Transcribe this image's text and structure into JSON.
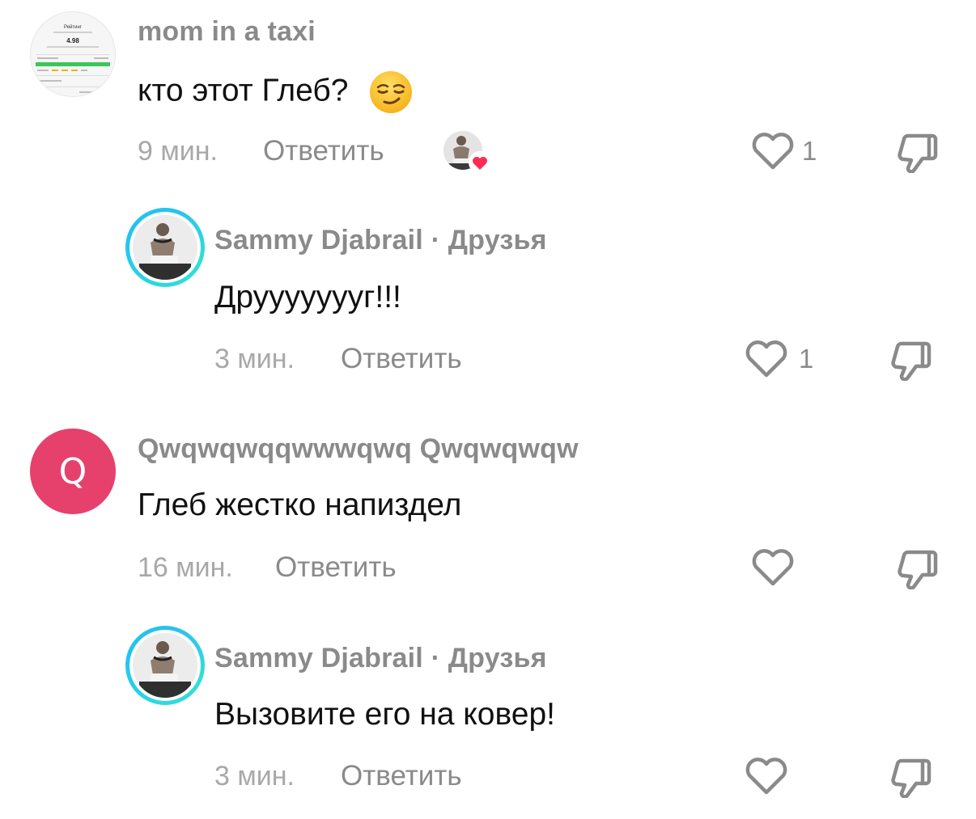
{
  "comments": [
    {
      "username": "mom in a taxi",
      "text": "кто этот Глеб?",
      "emoji": "smirking-face",
      "time": "9 мин.",
      "reply_label": "Ответить",
      "likes": "1",
      "avatar_thumb": {
        "title": "Рейтинг",
        "score": "4.98"
      }
    },
    {
      "username": "Sammy Djabrail",
      "separator": "·",
      "relation": "Друзья",
      "text": "Друууууууг!!!",
      "time": "3 мин.",
      "reply_label": "Ответить",
      "likes": "1"
    },
    {
      "username": "Qwqwqwqqwwwqwq Qwqwqwqw",
      "avatar_letter": "Q",
      "text": "Глеб жестко напиздел",
      "time": "16 мин.",
      "reply_label": "Ответить",
      "likes": ""
    },
    {
      "username": "Sammy Djabrail",
      "separator": "·",
      "relation": "Друзья",
      "text": "Вызовите его на ковер!",
      "time": "3 мин.",
      "reply_label": "Ответить",
      "likes": ""
    }
  ],
  "colors": {
    "letter_avatar": "#e6416c",
    "ring": "#2ed7e0",
    "heart_badge": "#fe2c55",
    "muted_text": "#8a8a8a"
  }
}
